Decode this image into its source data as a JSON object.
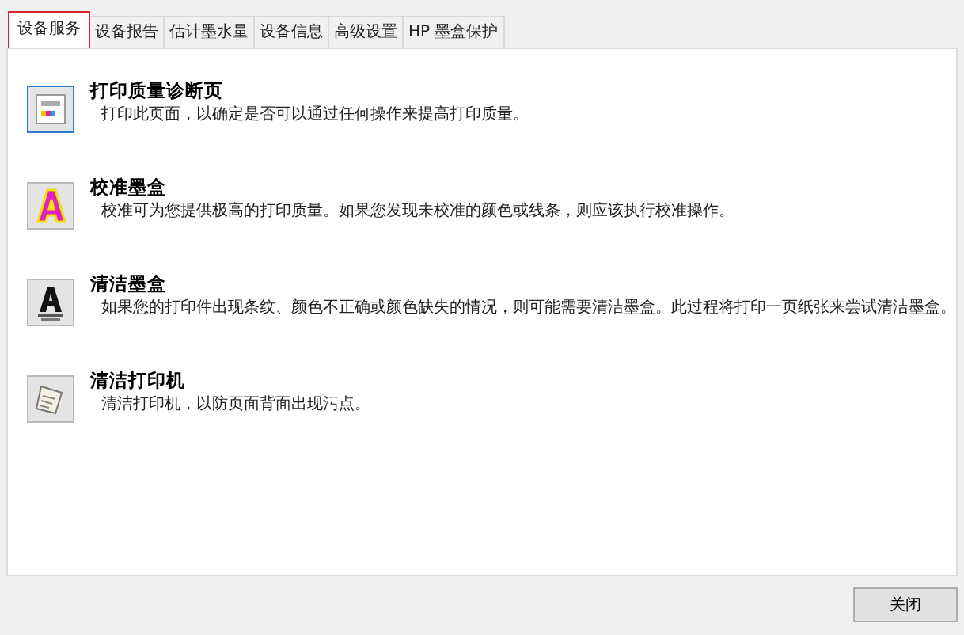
{
  "tabs": [
    {
      "label": "设备服务",
      "selected": true
    },
    {
      "label": "设备报告",
      "selected": false
    },
    {
      "label": "估计墨水量",
      "selected": false
    },
    {
      "label": "设备信息",
      "selected": false
    },
    {
      "label": "高级设置",
      "selected": false
    },
    {
      "label": "HP 墨盒保护",
      "selected": false
    }
  ],
  "services": [
    {
      "kind": "diagnostic",
      "title": "打印质量诊断页",
      "description": "打印此页面，以确定是否可以通过任何操作来提高打印质量。",
      "selected": true
    },
    {
      "kind": "align",
      "title": "校准墨盒",
      "description": "校准可为您提供极高的打印质量。如果您发现未校准的颜色或线条，则应该执行校准操作。",
      "selected": false
    },
    {
      "kind": "clean-cartridge",
      "title": "清洁墨盒",
      "description": "如果您的打印件出现条纹、颜色不正确或颜色缺失的情况，则可能需要清洁墨盒。此过程将打印一页纸张来尝试清洁墨盒。",
      "selected": false
    },
    {
      "kind": "clean-printer",
      "title": "清洁打印机",
      "description": "清洁打印机，以防页面背面出现污点。",
      "selected": false
    }
  ],
  "buttons": [
    "关闭"
  ]
}
